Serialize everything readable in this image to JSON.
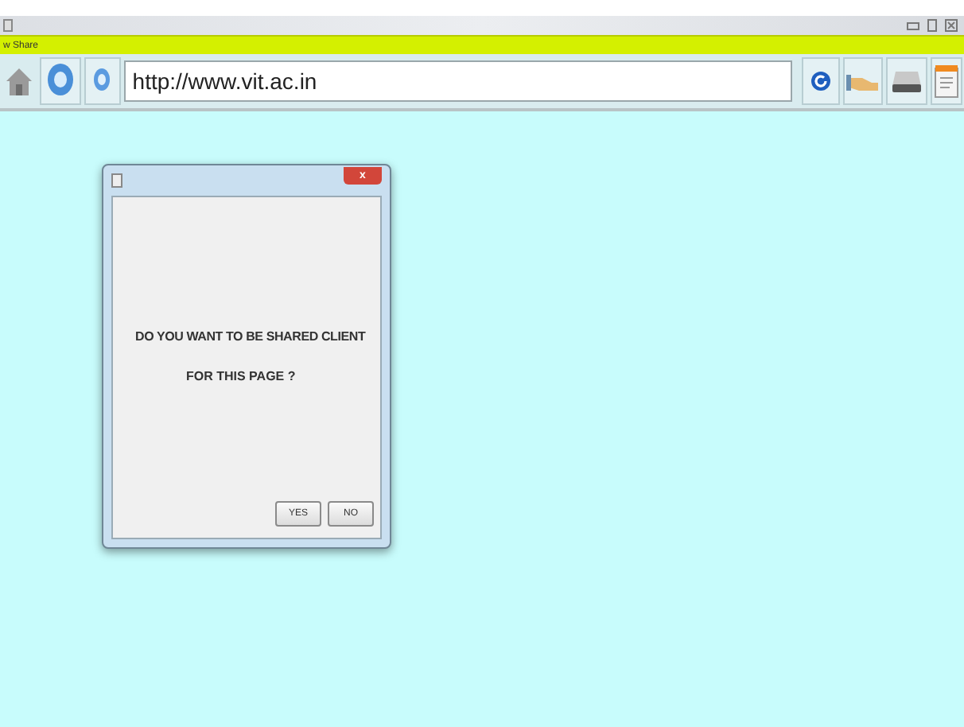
{
  "window": {
    "title": "w Share"
  },
  "toolbar": {
    "address": "http://www.vit.ac.in"
  },
  "dialog": {
    "close": "x",
    "message": [
      "DO YOU WANT TO BE SHARED CLIENT",
      "FOR THIS PAGE ?"
    ],
    "buttons": [
      "YES",
      "NO"
    ]
  }
}
